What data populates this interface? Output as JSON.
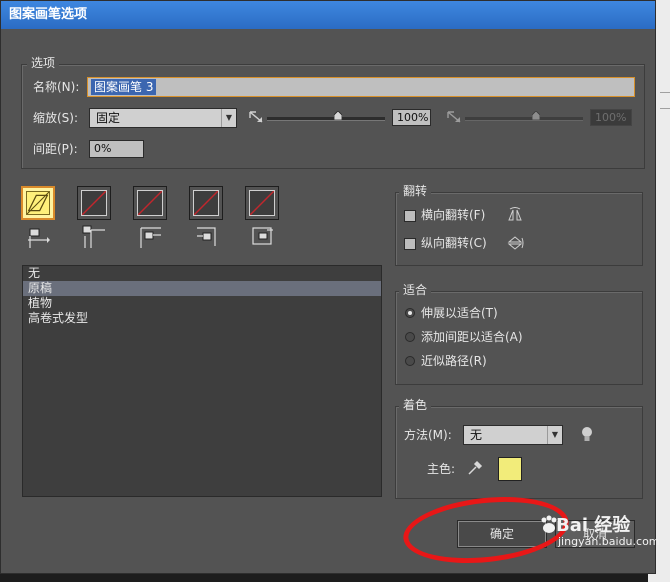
{
  "window": {
    "title": "图案画笔选项"
  },
  "options": {
    "legend": "选项",
    "name_label": "名称(N):",
    "name_value": "图案画笔 3",
    "scale_label": "缩放(S):",
    "scale_value": "固定",
    "scale_percent_1": "100%",
    "scale_percent_2": "100%",
    "scale_slider_1": 0.6,
    "scale_slider_2": 0.6,
    "spacing_label": "间距(P):",
    "spacing_value": "0%"
  },
  "tiles": [
    {
      "name": "side-tile",
      "selected": true
    },
    {
      "name": "outer-corner-tile",
      "selected": false
    },
    {
      "name": "inner-corner-tile",
      "selected": false
    },
    {
      "name": "start-tile",
      "selected": false
    },
    {
      "name": "end-tile",
      "selected": false
    }
  ],
  "pattern_list": {
    "items": [
      "无",
      "原稿",
      "植物",
      "高卷式发型"
    ],
    "selected_index": 1
  },
  "flip": {
    "legend": "翻转",
    "horizontal_label": "横向翻转(F)",
    "vertical_label": "纵向翻转(C)",
    "horizontal_checked": false,
    "vertical_checked": false
  },
  "fit": {
    "legend": "适合",
    "options": [
      "伸展以适合(T)",
      "添加间距以适合(A)",
      "近似路径(R)"
    ],
    "selected_index": 0
  },
  "colorization": {
    "legend": "着色",
    "method_label": "方法(M):",
    "method_value": "无",
    "key_color_label": "主色:",
    "key_color": "#f2ec7a"
  },
  "buttons": {
    "ok_label": "确定",
    "cancel_label": "取消"
  },
  "watermark": {
    "brand": "Bai 经验",
    "url": "jingyan.baidu.com"
  },
  "colors": {
    "accent": "#3c66b0",
    "highlight": "#e81717",
    "selected_border": "#d98a2a"
  }
}
